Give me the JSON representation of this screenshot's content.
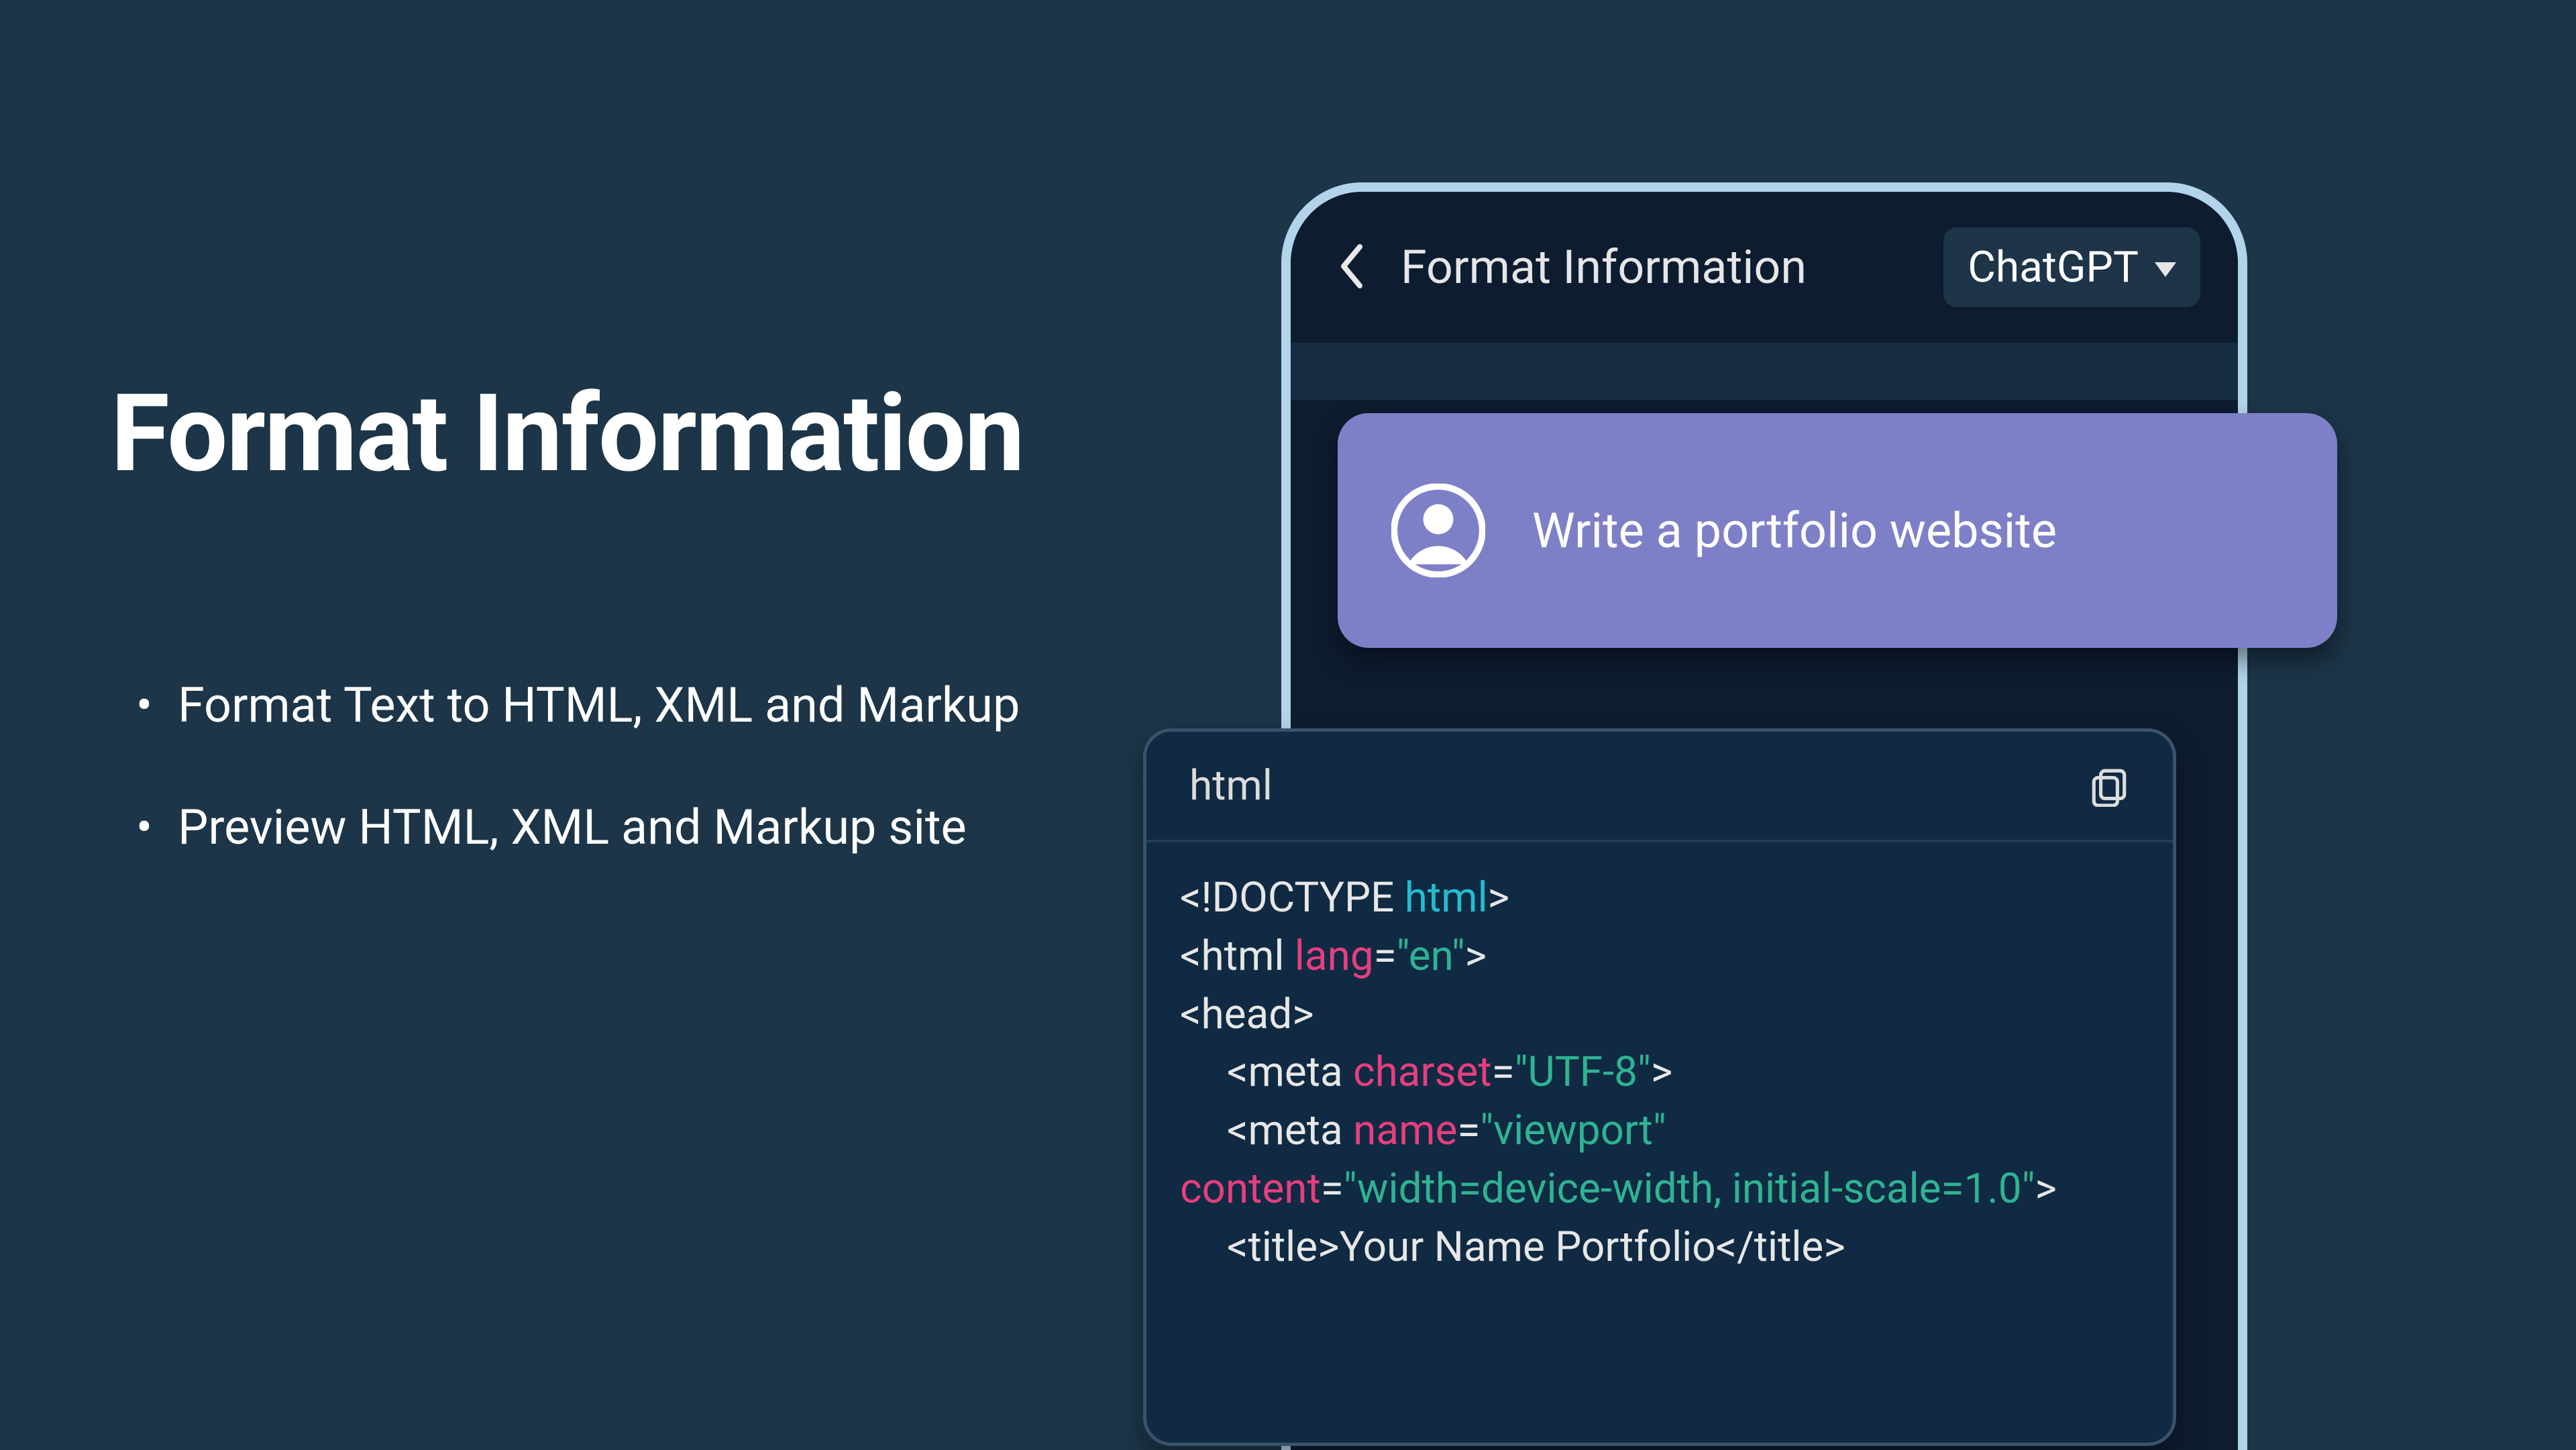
{
  "left": {
    "title": "Format Information",
    "bullets": [
      "Format Text to HTML, XML and Markup",
      "Preview HTML, XML and Markup site"
    ]
  },
  "phone": {
    "screen_title": "Format Information",
    "model": "ChatGPT",
    "user_message": "Write a portfolio website"
  },
  "code": {
    "lang": "html",
    "lines": [
      [
        [
          "",
          "<!DOCTYPE "
        ],
        [
          "kw",
          "html"
        ],
        [
          "",
          ">"
        ]
      ],
      [
        [
          "",
          "<html "
        ],
        [
          "attr",
          "lang"
        ],
        [
          "",
          "="
        ],
        [
          "str",
          "\"en\""
        ],
        [
          "",
          ">"
        ]
      ],
      [
        [
          "",
          "<head>"
        ]
      ],
      [
        [
          "ind",
          ""
        ],
        [
          "",
          "<meta "
        ],
        [
          "attr",
          "charset"
        ],
        [
          "",
          "="
        ],
        [
          "str",
          "\"UTF-8\""
        ],
        [
          "",
          ">"
        ]
      ],
      [
        [
          "ind",
          ""
        ],
        [
          "",
          "<meta "
        ],
        [
          "attr",
          "name"
        ],
        [
          "",
          "="
        ],
        [
          "str",
          "\"viewport\""
        ],
        [
          "",
          ""
        ]
      ],
      [
        [
          "attr",
          "content"
        ],
        [
          "",
          "="
        ],
        [
          "str",
          "\"width=device-width, initial-scale=1.0\""
        ],
        [
          "",
          ">"
        ]
      ],
      [
        [
          "ind",
          ""
        ],
        [
          "",
          "<title>Your Name Portfolio</title>"
        ]
      ]
    ]
  },
  "colors": {
    "background": "#1c3548",
    "phone_bg": "#0e1c30",
    "phone_border": "#b2d4eb",
    "code_bg": "#0f2a42",
    "bubble": "#7e80c7",
    "syntax_keyword": "#23bdd0",
    "syntax_attr": "#e63e7e",
    "syntax_string": "#2fb393"
  }
}
